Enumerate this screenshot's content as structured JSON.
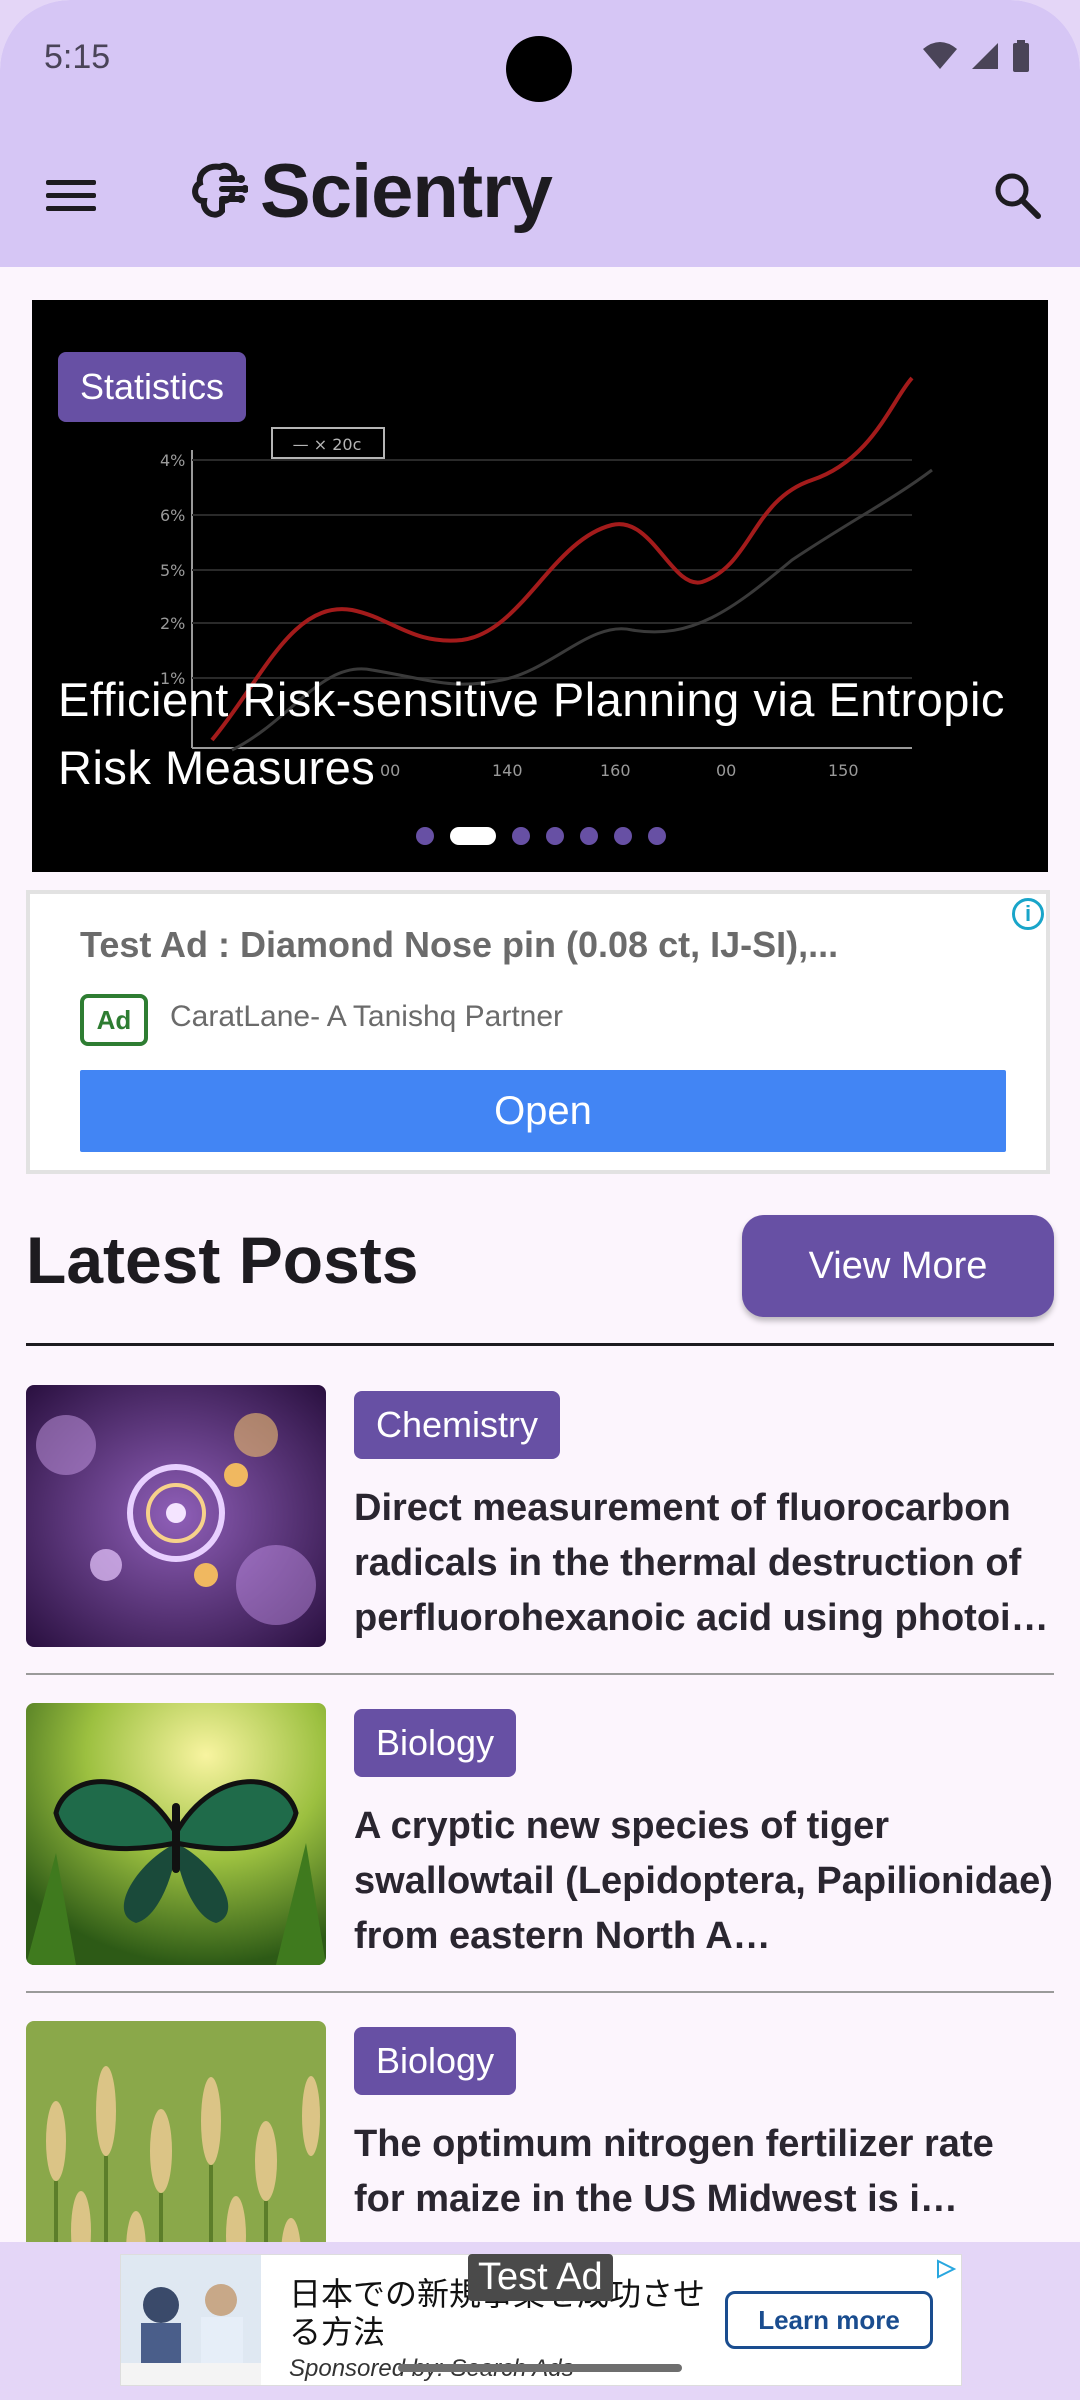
{
  "status_bar": {
    "time": "5:15"
  },
  "app_bar": {
    "title": "Scientry",
    "menu_icon": "menu-icon",
    "search_icon": "search-icon"
  },
  "hero": {
    "tag": "Statistics",
    "title": "Efficient Risk-sensitive Planning via Entropic Risk Measures",
    "slide_count": 7,
    "active_slide": 2
  },
  "ad_card": {
    "title": "Test Ad : Diamond Nose pin (0.08 ct, IJ-SI),...",
    "badge": "Ad",
    "advertiser": "CaratLane- A Tanishq Partner",
    "cta": "Open"
  },
  "latest": {
    "title": "Latest Posts",
    "view_more": "View More",
    "posts": [
      {
        "tag": "Chemistry",
        "title": "Direct measurement of fluorocarbon radicals in the thermal destruction of perfluorohexanoic acid using photoi…"
      },
      {
        "tag": "Biology",
        "title": "A cryptic new species of tiger swallowtail (Lepidoptera, Papilionidae) from eastern North A…"
      },
      {
        "tag": "Biology",
        "title": "The optimum nitrogen fertilizer rate for maize in the US Midwest is i…"
      }
    ]
  },
  "bottom_ad": {
    "line1": "日本での新規事業を成功させ",
    "line2": "る方法",
    "sponsor": "Sponsored by: Search Ads",
    "cta": "Learn more",
    "overlay": "Test Ad"
  },
  "colors": {
    "primary": "#6750a4",
    "app_bar": "#d6c6f5",
    "background": "#fcf5fd",
    "ad_button": "#4285f4"
  }
}
